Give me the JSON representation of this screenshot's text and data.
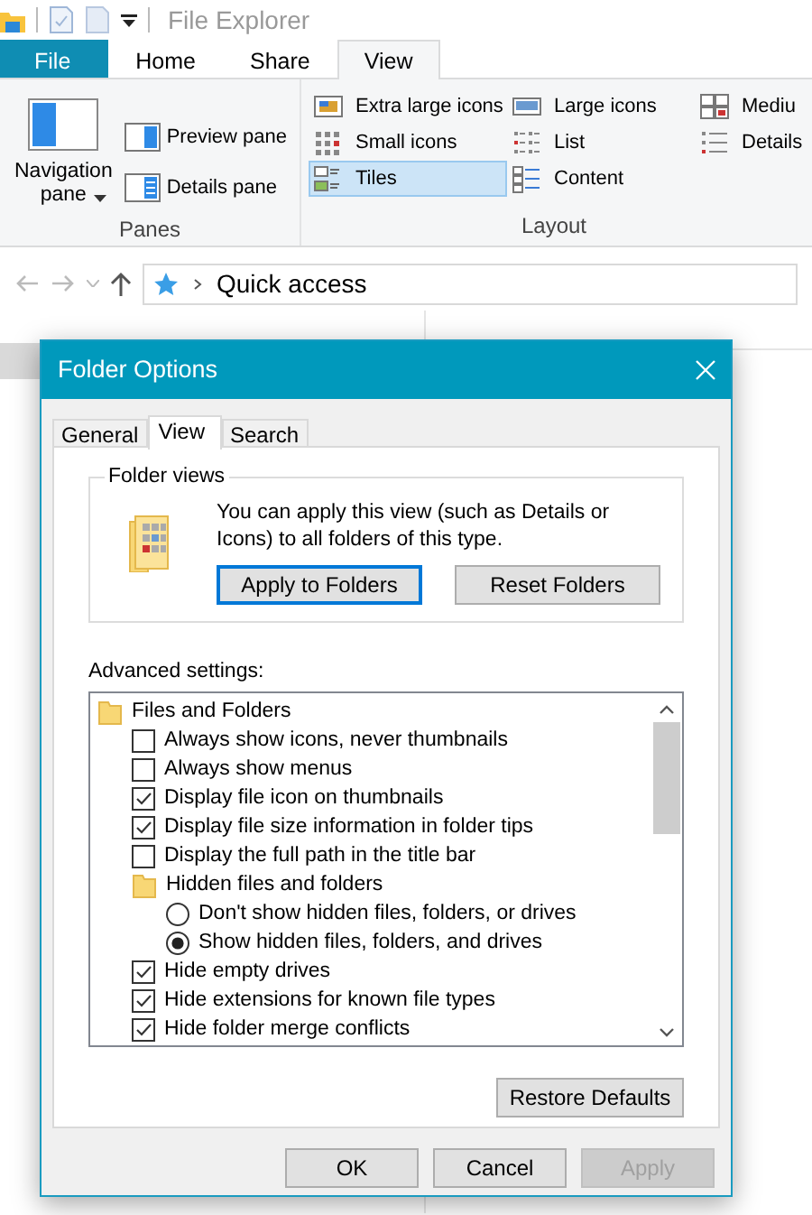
{
  "title_bar": {
    "title": "File Explorer"
  },
  "ribbon_tabs": [
    {
      "label": "File",
      "kind": "file",
      "selected": false
    },
    {
      "label": "Home",
      "kind": "tab",
      "selected": false
    },
    {
      "label": "Share",
      "kind": "tab",
      "selected": false
    },
    {
      "label": "View",
      "kind": "tab",
      "selected": true
    }
  ],
  "ribbon": {
    "panes": {
      "label": "Panes",
      "navigation": {
        "label": "Navigation pane"
      },
      "items": [
        {
          "label": "Preview pane",
          "kind": "preview"
        },
        {
          "label": "Details pane",
          "kind": "details"
        }
      ]
    },
    "layout": {
      "label": "Layout",
      "items": [
        {
          "label": "Extra large icons",
          "kind": "xl",
          "selected": false
        },
        {
          "label": "Large icons",
          "kind": "large",
          "selected": false
        },
        {
          "label": "Mediu",
          "kind": "medium",
          "selected": false
        },
        {
          "label": "Small icons",
          "kind": "small",
          "selected": false
        },
        {
          "label": "List",
          "kind": "list",
          "selected": false
        },
        {
          "label": "Details",
          "kind": "details",
          "selected": false
        },
        {
          "label": "Tiles",
          "kind": "tiles",
          "selected": true
        },
        {
          "label": "Content",
          "kind": "content",
          "selected": false
        }
      ]
    }
  },
  "address_bar": {
    "location": "Quick access"
  },
  "dialog": {
    "title": "Folder Options",
    "tabs": [
      {
        "label": "General",
        "selected": false
      },
      {
        "label": "View",
        "selected": true
      },
      {
        "label": "Search",
        "selected": false
      }
    ],
    "folder_views": {
      "legend": "Folder views",
      "text": "You can apply this view (such as Details or Icons) to all folders of this type.",
      "buttons": [
        {
          "label": "Apply to Folders",
          "focused": true
        },
        {
          "label": "Reset Folders",
          "focused": false
        }
      ]
    },
    "advanced_label": "Advanced settings:",
    "settings": [
      {
        "kind": "folder",
        "label": "Files and Folders",
        "children": [
          {
            "kind": "checkbox",
            "label": "Always show icons, never thumbnails",
            "checked": false
          },
          {
            "kind": "checkbox",
            "label": "Always show menus",
            "checked": false
          },
          {
            "kind": "checkbox",
            "label": "Display file icon on thumbnails",
            "checked": true
          },
          {
            "kind": "checkbox",
            "label": "Display file size information in folder tips",
            "checked": true
          },
          {
            "kind": "checkbox",
            "label": "Display the full path in the title bar",
            "checked": false
          },
          {
            "kind": "folder",
            "label": "Hidden files and folders",
            "children": [
              {
                "kind": "radio",
                "label": "Don't show hidden files, folders, or drives",
                "checked": false
              },
              {
                "kind": "radio",
                "label": "Show hidden files, folders, and drives",
                "checked": true
              }
            ]
          },
          {
            "kind": "checkbox",
            "label": "Hide empty drives",
            "checked": true
          },
          {
            "kind": "checkbox",
            "label": "Hide extensions for known file types",
            "checked": true
          },
          {
            "kind": "checkbox",
            "label": "Hide folder merge conflicts",
            "checked": true
          }
        ]
      }
    ],
    "restore_button": "Restore Defaults",
    "buttons": [
      {
        "label": "OK",
        "disabled": false
      },
      {
        "label": "Cancel",
        "disabled": false
      },
      {
        "label": "Apply",
        "disabled": true
      }
    ]
  }
}
